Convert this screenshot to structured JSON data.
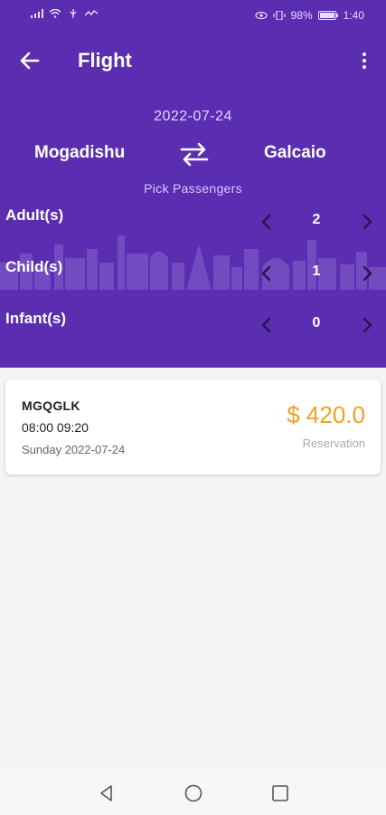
{
  "status_bar": {
    "battery": "98%",
    "time": "1:40"
  },
  "appbar": {
    "title": "Flight",
    "back_icon": "arrow-left-icon",
    "menu_icon": "more-vertical-icon"
  },
  "route": {
    "date": "2022-07-24",
    "from": "Mogadishu",
    "to": "Galcaio",
    "swap_icon": "swap-arrows-icon"
  },
  "passengers": {
    "heading": "Pick Passengers",
    "rows": [
      {
        "label": "Adult(s)",
        "value": "2"
      },
      {
        "label": "Child(s)",
        "value": "1"
      },
      {
        "label": "Infant(s)",
        "value": "0"
      }
    ]
  },
  "flights": [
    {
      "code": "MGQGLK",
      "times": "08:00 09:20",
      "date": "Sunday 2022-07-24",
      "price": "$ 420.0",
      "fare_type": "Reservation"
    }
  ],
  "colors": {
    "primary": "#5b2db0",
    "price": "#f0a020"
  }
}
